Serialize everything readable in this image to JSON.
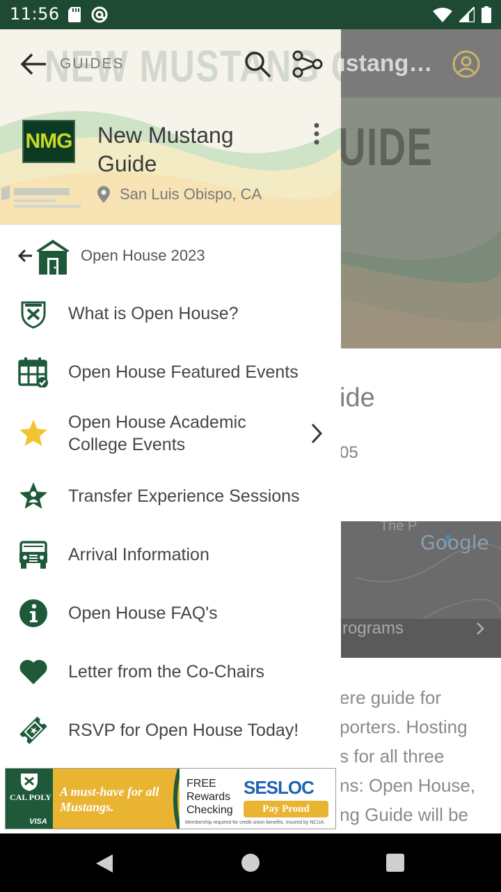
{
  "status_bar": {
    "time": "11:56"
  },
  "background_screen": {
    "title_fragment": "ustang…",
    "hero_word_fragment": "UIDE",
    "guide_heading_fragment": "ide",
    "code_fragment": "05",
    "map_label_fragment": "The P",
    "map_brand": "Google",
    "programs_fragment": "rograms",
    "paragraph_fragment": "ere guide for\nporters. Hosting\ns for all three\nns: Open House,\nng Guide will be"
  },
  "drawer": {
    "header_background_text": "NEW MUSTANG GUIDE",
    "section_label": "GUIDES",
    "logo_text": "NMG",
    "guide_title": "New Mustang Guide",
    "location": "San Luis Obispo, CA",
    "parent_group": "Open House 2023",
    "items": [
      {
        "label": "What is Open House?",
        "icon": "shield-crest-icon"
      },
      {
        "label": "Open House Featured Events",
        "icon": "calendar-check-icon"
      },
      {
        "label": "Open House Academic College Events",
        "icon": "star-icon",
        "has_children": true
      },
      {
        "label": "Transfer Experience Sessions",
        "icon": "person-star-icon"
      },
      {
        "label": "Arrival Information",
        "icon": "jeep-icon"
      },
      {
        "label": "Open House FAQ's",
        "icon": "info-icon"
      },
      {
        "label": "Letter from the Co-Chairs",
        "icon": "heart-icon"
      },
      {
        "label": "RSVP for Open House Today!",
        "icon": "ticket-icon"
      }
    ]
  },
  "ad": {
    "brand_left": "CAL POLY",
    "card_network": "VISA",
    "tagline": "A must-have for all Mustangs.",
    "offer": "FREE\nRewards\nChecking",
    "brand_right": "SESLOC",
    "cta": "Pay Proud",
    "fine_print": "Membership required for credit union benefits. Insured by NCUA."
  },
  "colors": {
    "status_bar": "#1e4a33",
    "accent_green": "#1e5a3a",
    "star_yellow": "#f2c530",
    "logo_lime": "#c7d92a"
  }
}
